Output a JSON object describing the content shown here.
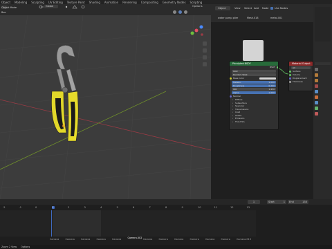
{
  "topbar": {
    "workspaces": [
      "Object",
      "Modeling",
      "Sculpting",
      "UV Editing",
      "Texture Paint",
      "Shading",
      "Animation",
      "Rendering",
      "Compositing",
      "Geometry Nodes",
      "Scripting"
    ]
  },
  "viewport": {
    "mode": "Object Mode",
    "transform_orientation": "Global",
    "options_label": "Options",
    "secondary_label": "Box"
  },
  "node_editor": {
    "editor_type": "Object",
    "menus": [
      "View",
      "Select",
      "Add",
      "Node"
    ],
    "use_nodes_label": "Use Nodes",
    "breadcrumb": [
      "water pump plier",
      "Mesh.018",
      "metal.001"
    ],
    "bsdf_node": {
      "title": "Principled BSDF",
      "output_label": "BSDF",
      "distribution": "GGX",
      "subsurface_method": "Random Walk",
      "rows": [
        "Base Color",
        "Metallic",
        "Roughness",
        "IOR",
        "Alpha",
        "Normal"
      ],
      "values": {
        "metallic": "1.000",
        "roughness": "0.200",
        "ior": "1.450",
        "alpha": "1.000"
      },
      "panels": [
        "Diffuse",
        "Subsurface",
        "Specular",
        "Transmission",
        "Coat",
        "Sheen",
        "Emission",
        "Thin Film"
      ]
    },
    "output_node": {
      "title": "Material Output",
      "target": "All",
      "sockets": [
        "Surface",
        "Volume",
        "Displacement",
        "Thickness"
      ]
    }
  },
  "timeline": {
    "current_frame": "1",
    "start_label": "Start",
    "start_value": "1",
    "end_label": "End",
    "end_value": "130",
    "ticks": [
      "-2",
      "-1",
      "0",
      "1",
      "2",
      "3",
      "4",
      "5",
      "6",
      "7",
      "8",
      "9",
      "10",
      "11",
      "12",
      "13"
    ],
    "markers": [
      "Camera",
      "Camera",
      "Camera",
      "Camera",
      "Camera",
      "Camera.002",
      "Camera",
      "Camera",
      "Camera",
      "Camera",
      "Camera",
      "Camera",
      "Camera.013"
    ],
    "status": [
      "Zoom 2 View",
      "Options"
    ]
  },
  "colors": {
    "accent": "#4772b3",
    "frame": "#3f6ac0",
    "bsdf_header": "#276b3a",
    "output_header": "#8d2a2a",
    "shader_socket": "#63c763"
  }
}
